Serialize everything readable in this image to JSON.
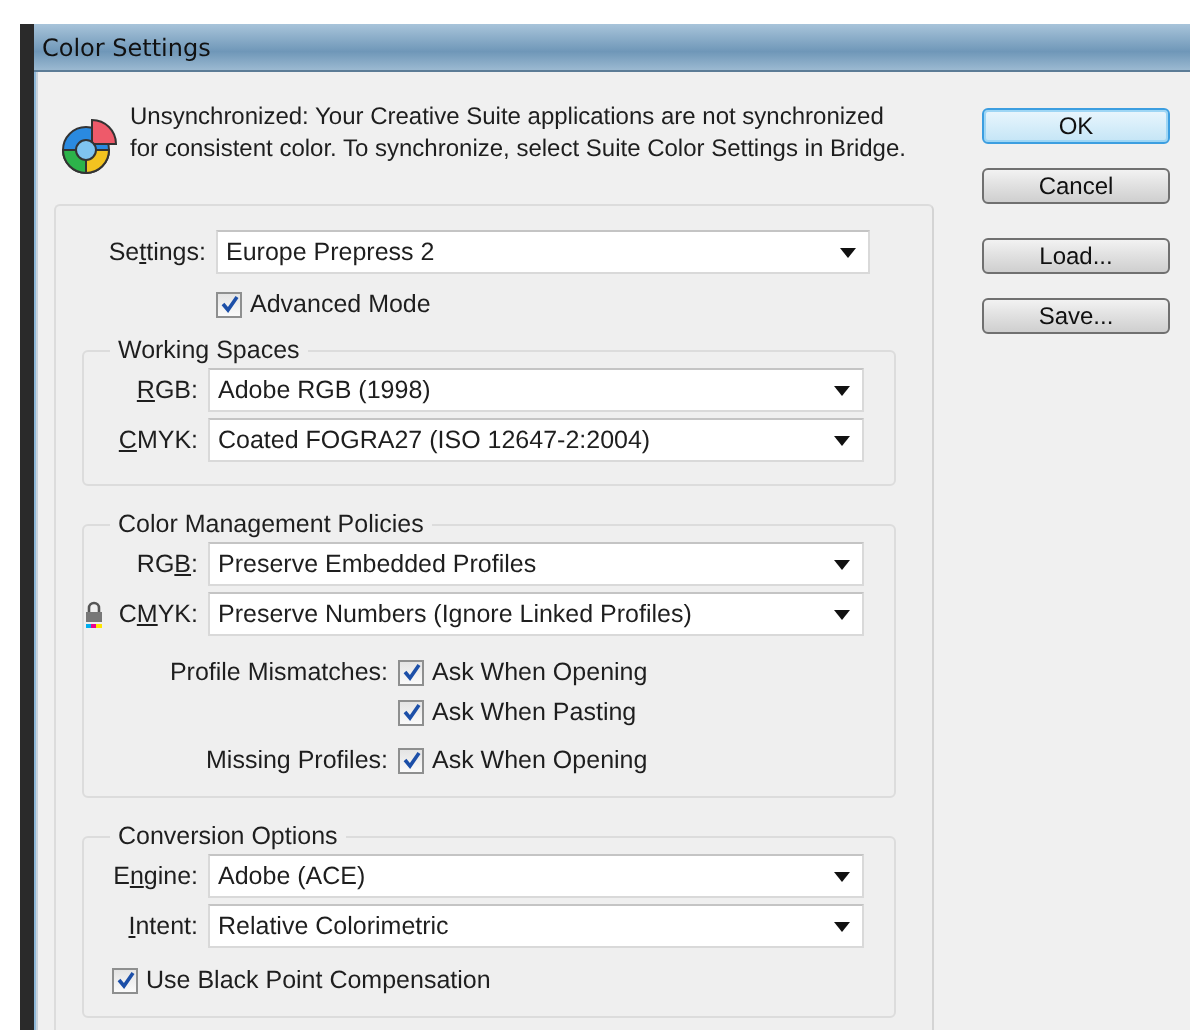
{
  "window": {
    "title": "Color Settings"
  },
  "message": {
    "lines": [
      "Unsynchronized: Your Creative Suite applications are not synchronized",
      "for consistent color. To synchronize, select Suite Color Settings in Bridge."
    ]
  },
  "buttons": [
    {
      "label": "OK",
      "default": true
    },
    {
      "label": "Cancel",
      "default": false
    },
    {
      "label": "Load...",
      "default": false
    },
    {
      "label": "Save...",
      "default": false
    }
  ],
  "settings": {
    "label": {
      "before": "Se",
      "key": "t",
      "after": "tings:"
    },
    "value": "Europe Prepress 2"
  },
  "advanced_mode": {
    "label": "Advanced Mode",
    "checked": true
  },
  "groups": [
    {
      "title": "Working Spaces",
      "rows": [
        {
          "kind": "select",
          "label": {
            "key": "R",
            "after": "GB:"
          },
          "value": "Adobe RGB (1998)",
          "locked": false
        },
        {
          "kind": "select",
          "label": {
            "key": "C",
            "after": "MYK:"
          },
          "value": "Coated FOGRA27 (ISO 12647-2:2004)",
          "locked": false
        }
      ]
    },
    {
      "title": "Color Management Policies",
      "rows": [
        {
          "kind": "select",
          "label": {
            "before": "RG",
            "key": "B",
            "after": ":"
          },
          "value": "Preserve Embedded Profiles",
          "locked": false
        },
        {
          "kind": "select",
          "label": {
            "before": "C",
            "key": "M",
            "after": "YK:"
          },
          "value": "Preserve Numbers (Ignore Linked Profiles)",
          "locked": true
        },
        {
          "kind": "checks",
          "label": "Profile Mismatches:",
          "options": [
            {
              "label": "Ask When Opening",
              "checked": true
            },
            {
              "label": "Ask When Pasting",
              "checked": true
            }
          ]
        },
        {
          "kind": "checks",
          "label": "Missing Profiles:",
          "options": [
            {
              "label": "Ask When Opening",
              "checked": true
            }
          ]
        }
      ]
    },
    {
      "title": "Conversion Options",
      "rows": [
        {
          "kind": "select",
          "label": {
            "before": "E",
            "key": "n",
            "after": "gine:"
          },
          "value": "Adobe (ACE)",
          "locked": false
        },
        {
          "kind": "select",
          "label": {
            "key": "I",
            "after": "ntent:"
          },
          "value": "Relative Colorimetric",
          "locked": false
        },
        {
          "kind": "check",
          "label": "Use Black Point Compensation",
          "checked": true
        }
      ]
    }
  ]
}
